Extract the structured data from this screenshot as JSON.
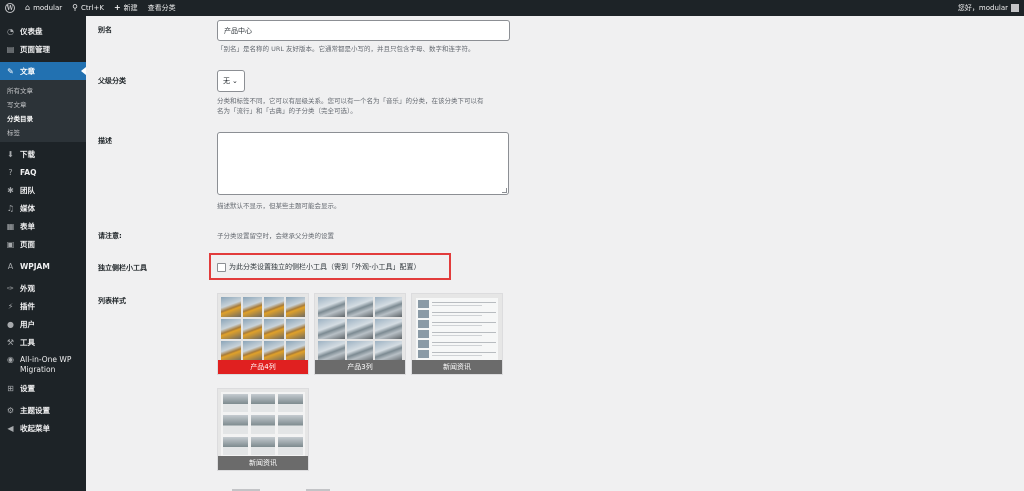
{
  "adminbar": {
    "site_name": "modular",
    "search_shortcut": "Ctrl+K",
    "new_label": "新建",
    "view_category_label": "查看分类",
    "greeting": "您好，modular"
  },
  "sidebar": {
    "items": [
      {
        "label": "仪表盘",
        "icon": "dashboard-icon"
      },
      {
        "label": "页面管理",
        "icon": "pages-icon"
      },
      {
        "label": "文章",
        "icon": "pin-icon",
        "active": true
      },
      {
        "label": "下载",
        "icon": "download-icon"
      },
      {
        "label": "FAQ",
        "icon": "question-icon"
      },
      {
        "label": "团队",
        "icon": "team-icon"
      },
      {
        "label": "媒体",
        "icon": "media-icon"
      },
      {
        "label": "表单",
        "icon": "form-icon"
      },
      {
        "label": "页面",
        "icon": "page-icon"
      },
      {
        "label": "WPJAM",
        "icon": "wpjam-icon"
      },
      {
        "label": "外观",
        "icon": "brush-icon"
      },
      {
        "label": "插件",
        "icon": "plugin-icon"
      },
      {
        "label": "用户",
        "icon": "user-icon"
      },
      {
        "label": "工具",
        "icon": "wrench-icon"
      },
      {
        "label": "All-in-One WP Migration",
        "icon": "migration-icon"
      },
      {
        "label": "设置",
        "icon": "settings-icon"
      },
      {
        "label": "主题设置",
        "icon": "theme-settings-icon"
      },
      {
        "label": "收起菜单",
        "icon": "collapse-icon"
      }
    ],
    "submenu": [
      {
        "label": "所有文章"
      },
      {
        "label": "写文章"
      },
      {
        "label": "分类目录",
        "current": true
      },
      {
        "label": "标签"
      }
    ]
  },
  "form": {
    "slug": {
      "label": "别名",
      "value": "产品中心",
      "description": "「别名」是名称的 URL 友好版本。它通常都是小写的，并且只包含字母、数字和连字符。"
    },
    "parent": {
      "label": "父级分类",
      "value": "无",
      "description_1": "分类和标签不同，它可以有层级关系。您可以有一个名为「音乐」的分类，在该分类下可以有",
      "description_2": "名为「流行」和「古典」的子分类（完全可选）。"
    },
    "description": {
      "label": "描述",
      "value": "",
      "help": "描述默认不显示，但某些主题可能会显示。"
    },
    "notice": {
      "label": "请注意:",
      "text": "子分类设置留空时，会继承父分类的设置"
    },
    "sidebar_widget": {
      "label": "独立侧栏小工具",
      "checkbox_label": "为此分类设置独立的侧栏小工具（需到「外观-小工具」配置）",
      "checked": false,
      "highlight_color": "#e23c3c"
    },
    "list_style": {
      "label": "列表样式",
      "options": [
        {
          "caption": "产品4列",
          "selected": true
        },
        {
          "caption": "产品3列",
          "selected": false
        },
        {
          "caption": "新闻资讯",
          "selected": false
        },
        {
          "caption": "新闻资讯",
          "selected": false
        }
      ]
    }
  },
  "colors": {
    "sidebar_bg": "#1d2327",
    "active_blue": "#2271b1",
    "selected_red": "#e02020"
  }
}
